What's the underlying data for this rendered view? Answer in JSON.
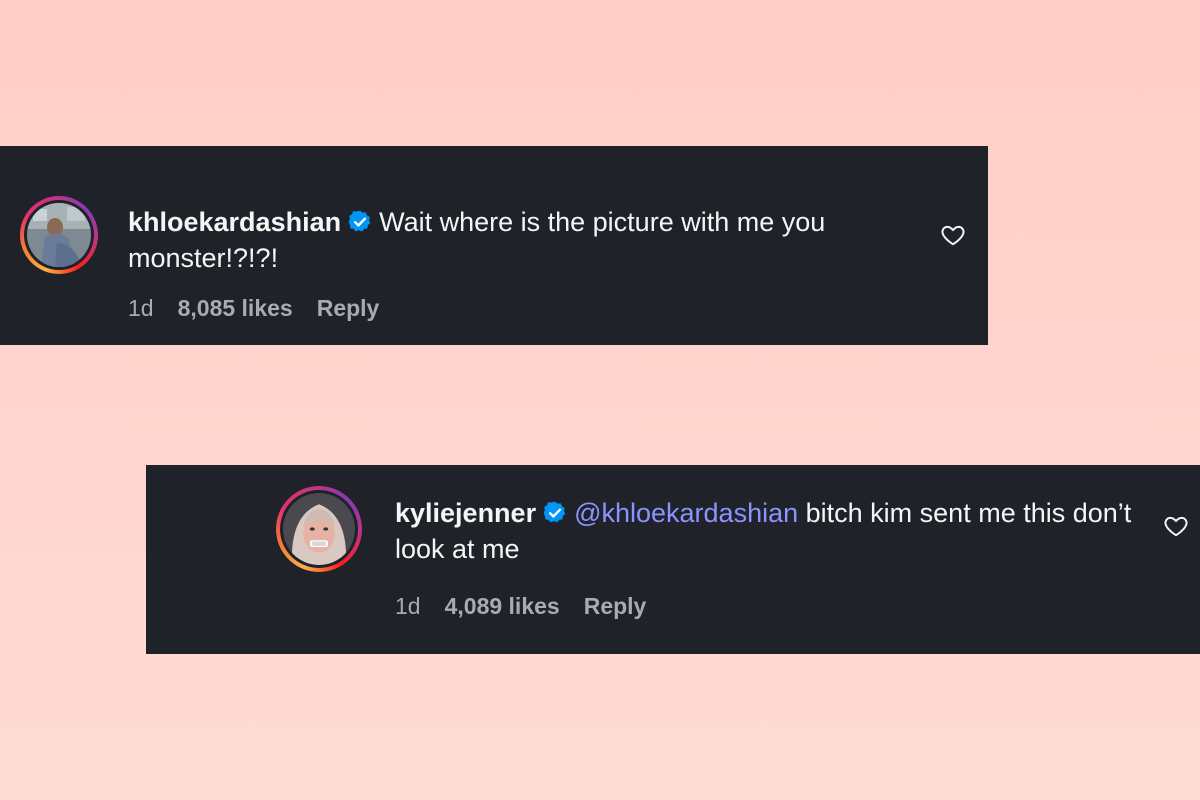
{
  "comments": [
    {
      "username": "khloekardashian",
      "text": "Wait where is the picture with me you monster!?!?!",
      "time": "1d",
      "likes": "8,085 likes",
      "reply_label": "Reply",
      "avatar_icon": "profile-photo",
      "verified_icon": "verified-badge-icon",
      "like_icon": "heart-outline-icon"
    },
    {
      "username": "kyliejenner",
      "mention": "@khloekardashian",
      "text": "bitch kim sent me this don’t look at me",
      "time": "1d",
      "likes": "4,089 likes",
      "reply_label": "Reply",
      "avatar_icon": "profile-photo",
      "verified_icon": "verified-badge-icon",
      "like_icon": "heart-outline-icon"
    }
  ],
  "colors": {
    "background": "#ffcdc6",
    "card": "#202229",
    "text": "#f5f5f5",
    "muted": "#a8abb3",
    "mention": "#8b93ff",
    "verified": "#0095f6"
  }
}
